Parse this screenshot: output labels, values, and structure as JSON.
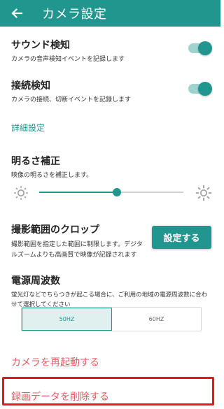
{
  "appbar": {
    "title": "カメラ設定",
    "back_icon": "arrow-back-icon",
    "color": "#20968f"
  },
  "sound_detect": {
    "title": "サウンド検知",
    "subtitle": "カメラの音声検知イベントを記録します",
    "enabled": true
  },
  "connection_detect": {
    "title": "接続検知",
    "subtitle": "カメラの接続、切断イベントを記録します",
    "enabled": true
  },
  "advanced_header": "詳細設定",
  "brightness": {
    "title": "明るさ補正",
    "subtitle": "映像の明るさを補正します。",
    "value_fraction": 0.54,
    "min_icon": "brightness-low-icon",
    "max_icon": "brightness-high-icon"
  },
  "crop": {
    "title": "撮影範囲のクロップ",
    "subtitle_line1": "撮影範囲を指定した範囲に制限します。デジタ",
    "subtitle_line2": "ルズームよりも高画質で映像が記録されます",
    "button_label": "設定する"
  },
  "power_freq": {
    "title": "電源周波数",
    "subtitle_line1": "蛍光灯などでちらつきが起こる場合に、ご利用の地域の電源周波数に合わ",
    "subtitle_line2": "せて選択してください",
    "options": [
      "50HZ",
      "60HZ"
    ],
    "selected": "50HZ"
  },
  "restart_label": "カメラを再起動する",
  "delete_label": "録画データを削除する",
  "colors": {
    "accent": "#20968f",
    "danger_text": "#e35b64",
    "highlight_border": "#e8141e"
  }
}
